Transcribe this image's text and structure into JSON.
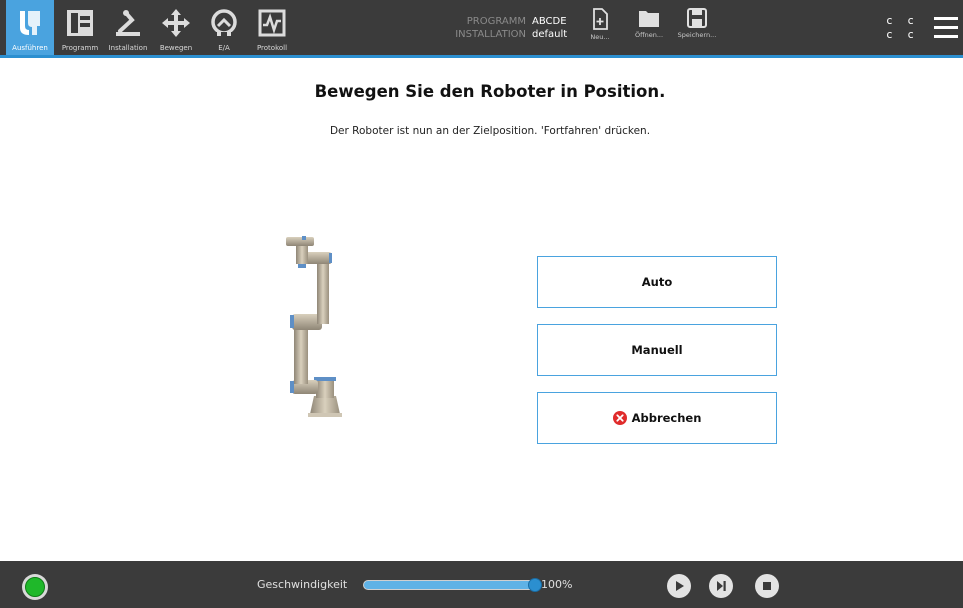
{
  "header": {
    "nav_tabs": [
      {
        "label": "Ausführen",
        "icon": "ur-logo-icon",
        "active": true
      },
      {
        "label": "Programm",
        "icon": "program-icon",
        "active": false
      },
      {
        "label": "Installation",
        "icon": "installation-icon",
        "active": false
      },
      {
        "label": "Bewegen",
        "icon": "move-icon",
        "active": false
      },
      {
        "label": "E/A",
        "icon": "io-icon",
        "active": false
      },
      {
        "label": "Protokoll",
        "icon": "log-icon",
        "active": false
      }
    ],
    "program_label": "PROGRAMM",
    "program_value": "ABCDE",
    "installation_label": "INSTALLATION",
    "installation_value": "default",
    "file_buttons": [
      {
        "label": "Neu...",
        "icon": "new-file-icon"
      },
      {
        "label": "Öffnen...",
        "icon": "open-folder-icon"
      },
      {
        "label": "Speichern...",
        "icon": "save-icon"
      }
    ],
    "cc_row1": "c c",
    "cc_row2": "c c"
  },
  "main": {
    "title": "Bewegen Sie den Roboter in Position.",
    "subtitle": "Der Roboter ist nun an der Zielposition. 'Fortfahren' drücken.",
    "buttons": {
      "auto": "Auto",
      "manual": "Manuell",
      "cancel": "Abbrechen"
    }
  },
  "footer": {
    "speed_label": "Geschwindigkeit",
    "speed_value": "100%",
    "speed_fraction": 1.0
  },
  "colors": {
    "header_bg": "#3b3b3b",
    "accent": "#4aa3df",
    "cancel_red": "#e02b2b",
    "power_green": "#1fb82a"
  }
}
